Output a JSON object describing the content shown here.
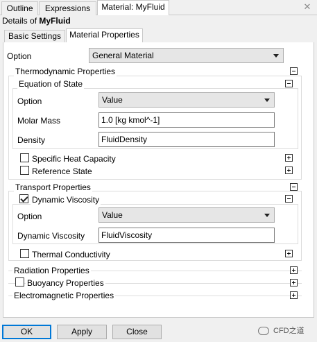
{
  "tabs": [
    {
      "label": "Outline"
    },
    {
      "label": "Expressions"
    },
    {
      "label": "Material: MyFluid"
    }
  ],
  "close_glyph": "✕",
  "details": {
    "prefix": "Details of ",
    "name": "MyFluid"
  },
  "subtabs": [
    {
      "label": "Basic Settings"
    },
    {
      "label": "Material Properties"
    }
  ],
  "option_row": {
    "label": "Option",
    "value": "General Material"
  },
  "thermo": {
    "title": "Thermodynamic Properties",
    "eos": {
      "title": "Equation of State",
      "option_label": "Option",
      "option_value": "Value",
      "molar_mass_label": "Molar Mass",
      "molar_mass_value": "1.0 [kg kmol^-1]",
      "density_label": "Density",
      "density_value": "FluidDensity"
    },
    "specific_heat_label": "Specific Heat Capacity",
    "reference_state_label": "Reference State"
  },
  "transport": {
    "title": "Transport Properties",
    "dyn": {
      "title": "Dynamic Viscosity",
      "checked": true,
      "option_label": "Option",
      "option_value": "Value",
      "value_label": "Dynamic Viscosity",
      "value": "FluidViscosity"
    },
    "thermal_label": "Thermal Conductivity"
  },
  "radiation_label": "Radiation Properties",
  "buoyancy_label": "Buoyancy Properties",
  "electromagnetic_label": "Electromagnetic Properties",
  "buttons": {
    "ok": "OK",
    "apply": "Apply",
    "close": "Close"
  },
  "watermark": "CFD之道"
}
